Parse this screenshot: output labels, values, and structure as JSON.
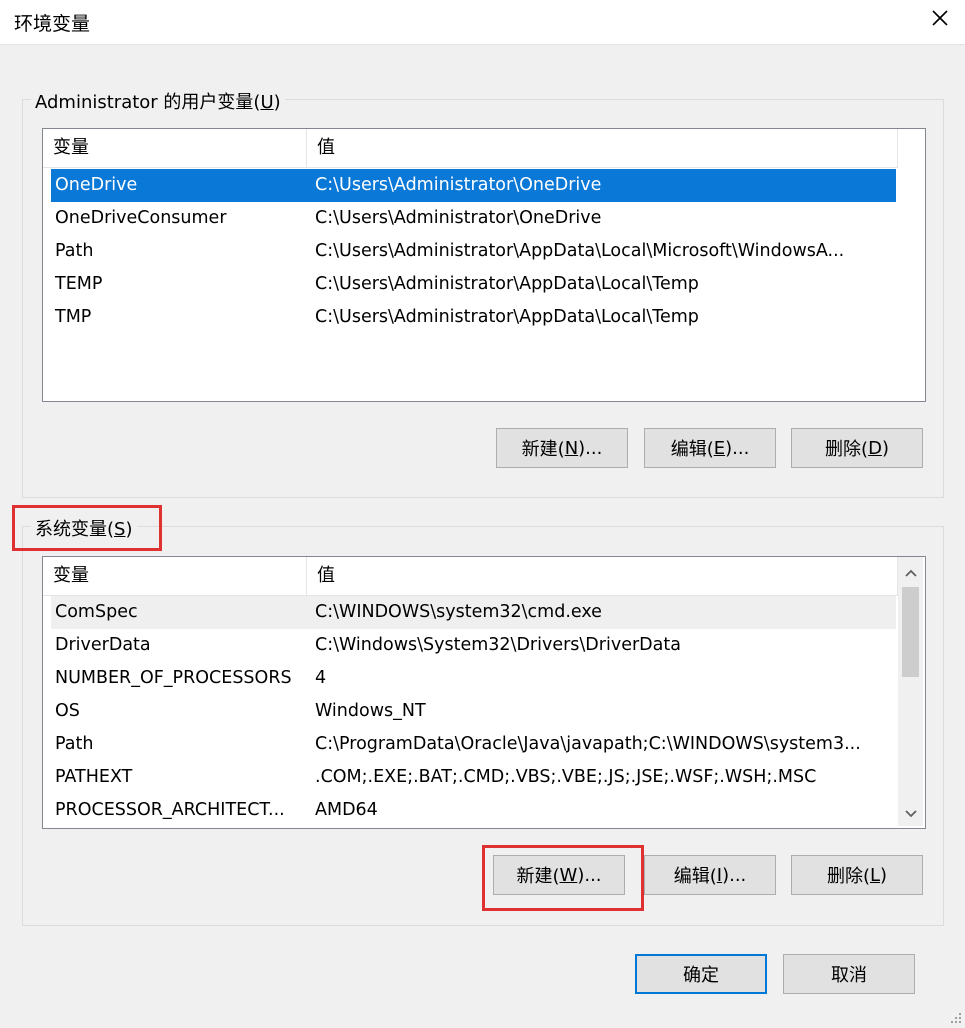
{
  "window": {
    "title": "环境变量"
  },
  "user_vars": {
    "group_label_prefix": "Administrator 的用户变量(",
    "group_label_key": "U",
    "group_label_suffix": ")",
    "columns": [
      "变量",
      "值"
    ],
    "rows": [
      {
        "name": "OneDrive",
        "value": "C:\\Users\\Administrator\\OneDrive"
      },
      {
        "name": "OneDriveConsumer",
        "value": "C:\\Users\\Administrator\\OneDrive"
      },
      {
        "name": "Path",
        "value": "C:\\Users\\Administrator\\AppData\\Local\\Microsoft\\WindowsA..."
      },
      {
        "name": "TEMP",
        "value": "C:\\Users\\Administrator\\AppData\\Local\\Temp"
      },
      {
        "name": "TMP",
        "value": "C:\\Users\\Administrator\\AppData\\Local\\Temp"
      }
    ],
    "selected_row": "OneDrive",
    "buttons": {
      "new": {
        "pre": "新建(",
        "key": "N",
        "post": ")..."
      },
      "edit": {
        "pre": "编辑(",
        "key": "E",
        "post": ")..."
      },
      "delete": {
        "pre": "删除(",
        "key": "D",
        "post": ")"
      }
    }
  },
  "system_vars": {
    "group_label_prefix": "系统变量(",
    "group_label_key": "S",
    "group_label_suffix": ")",
    "columns": [
      "变量",
      "值"
    ],
    "rows": [
      {
        "name": "ComSpec",
        "value": "C:\\WINDOWS\\system32\\cmd.exe"
      },
      {
        "name": "DriverData",
        "value": "C:\\Windows\\System32\\Drivers\\DriverData"
      },
      {
        "name": "NUMBER_OF_PROCESSORS",
        "value": "4"
      },
      {
        "name": "OS",
        "value": "Windows_NT"
      },
      {
        "name": "Path",
        "value": "C:\\ProgramData\\Oracle\\Java\\javapath;C:\\WINDOWS\\system3..."
      },
      {
        "name": "PATHEXT",
        "value": ".COM;.EXE;.BAT;.CMD;.VBS;.VBE;.JS;.JSE;.WSF;.WSH;.MSC"
      },
      {
        "name": "PROCESSOR_ARCHITECT...",
        "value": "AMD64"
      }
    ],
    "highlighted_row": "ComSpec",
    "buttons": {
      "new": {
        "pre": "新建(",
        "key": "W",
        "post": ")..."
      },
      "edit": {
        "pre": "编辑(",
        "key": "I",
        "post": ")..."
      },
      "delete": {
        "pre": "删除(",
        "key": "L",
        "post": ")"
      }
    }
  },
  "footer": {
    "ok": "确定",
    "cancel": "取消"
  },
  "colors": {
    "selection": "#0a78d7",
    "annotation": "#e03131",
    "default_button_border": "#0078d7"
  },
  "icons": {
    "close": "close-icon",
    "scroll_up": "chevron-up-icon",
    "scroll_down": "chevron-down-icon"
  }
}
